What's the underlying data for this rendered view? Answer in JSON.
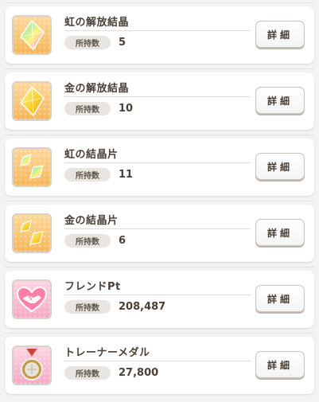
{
  "items": [
    {
      "name": "虹の解放結晶",
      "owned_label": "所持数",
      "count": "5",
      "detail_label": "詳細",
      "icon": "rainbow-crystal-icon",
      "theme": "orange"
    },
    {
      "name": "金の解放結晶",
      "owned_label": "所持数",
      "count": "10",
      "detail_label": "詳細",
      "icon": "gold-crystal-icon",
      "theme": "orange"
    },
    {
      "name": "虹の結晶片",
      "owned_label": "所持数",
      "count": "11",
      "detail_label": "詳細",
      "icon": "rainbow-shard-icon",
      "theme": "orange"
    },
    {
      "name": "金の結晶片",
      "owned_label": "所持数",
      "count": "6",
      "detail_label": "詳細",
      "icon": "gold-shard-icon",
      "theme": "orange"
    },
    {
      "name": "フレンドPt",
      "owned_label": "所持数",
      "count": "208,487",
      "detail_label": "詳細",
      "icon": "handshake-icon",
      "theme": "pink"
    },
    {
      "name": "トレーナーメダル",
      "owned_label": "所持数",
      "count": "27,800",
      "detail_label": "詳細",
      "icon": "medal-icon",
      "theme": "pink"
    }
  ],
  "colors": {
    "text": "#4a4036",
    "orange_tile": "#f7b65a",
    "pink_tile": "#f7a9c6"
  }
}
